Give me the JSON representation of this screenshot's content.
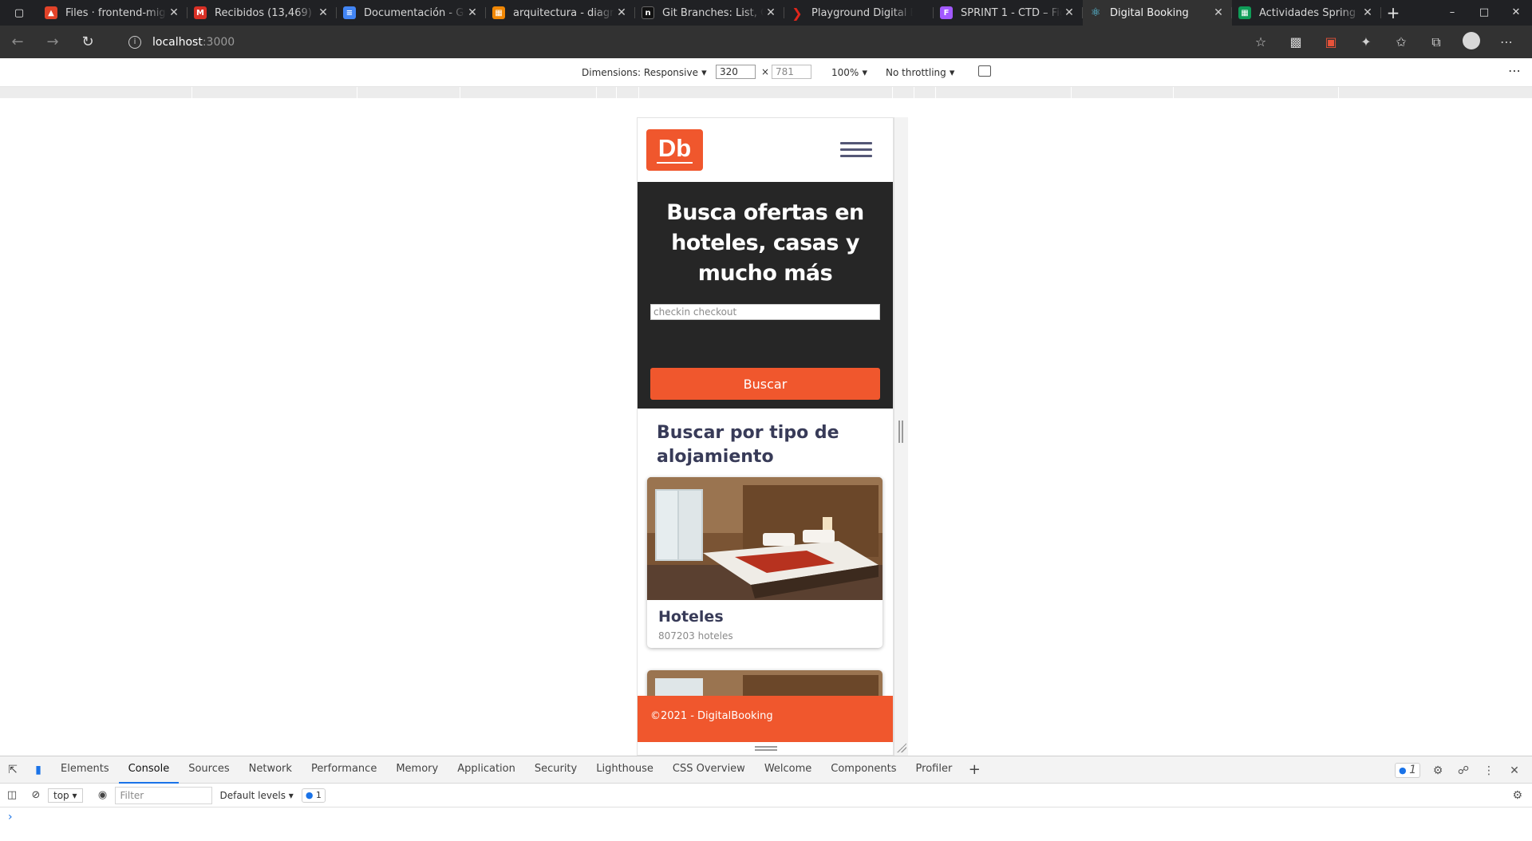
{
  "browser": {
    "tabs": [
      {
        "label": "Files · frontend-mig",
        "icon": "gitlab-icon",
        "color": "#e24329"
      },
      {
        "label": "Recibidos (13,469) -",
        "icon": "gmail-icon",
        "color": "#d93025"
      },
      {
        "label": "Documentación - Gr",
        "icon": "docs-icon",
        "color": "#4285f4"
      },
      {
        "label": "arquitectura - diagra",
        "icon": "drawio-icon",
        "color": "#f08705"
      },
      {
        "label": "Git Branches: List, C",
        "icon": "notion-icon",
        "color": "#111111"
      },
      {
        "label": "Playground Digital B",
        "icon": "play-icon",
        "color": "#e0261b"
      },
      {
        "label": "SPRINT 1 - CTD – Fig",
        "icon": "figma-icon",
        "color": "#a259ff"
      },
      {
        "label": "Digital Booking",
        "icon": "react-icon",
        "color": "#61dafb",
        "active": true
      },
      {
        "label": "Actividades Spring",
        "icon": "sheets-icon",
        "color": "#0f9d58"
      }
    ],
    "url_host": "localhost",
    "url_port": ":3000"
  },
  "device_toolbar": {
    "dimensions_label": "Dimensions: Responsive",
    "width": "320",
    "height": "781",
    "zoom": "100%",
    "throttling": "No throttling"
  },
  "site": {
    "logo": "Db",
    "hero_title": "Busca ofertas en hoteles, casas y mucho más",
    "search_placeholder": "checkin checkout",
    "search_button": "Buscar",
    "section_title": "Buscar por tipo de alojamiento",
    "cards": [
      {
        "title": "Hoteles",
        "subtitle": "807203 hoteles"
      }
    ],
    "footer": "©2021 - DigitalBooking",
    "brand_color": "#f0572d",
    "hero_bg": "#262626"
  },
  "devtools": {
    "tabs": [
      "Elements",
      "Console",
      "Sources",
      "Network",
      "Performance",
      "Memory",
      "Application",
      "Security",
      "Lighthouse",
      "CSS Overview",
      "Welcome",
      "Components",
      "Profiler"
    ],
    "active_tab": "Console",
    "issues_count": "1",
    "context": "top",
    "filter_placeholder": "Filter",
    "levels": "Default levels",
    "messages_count": "1"
  }
}
